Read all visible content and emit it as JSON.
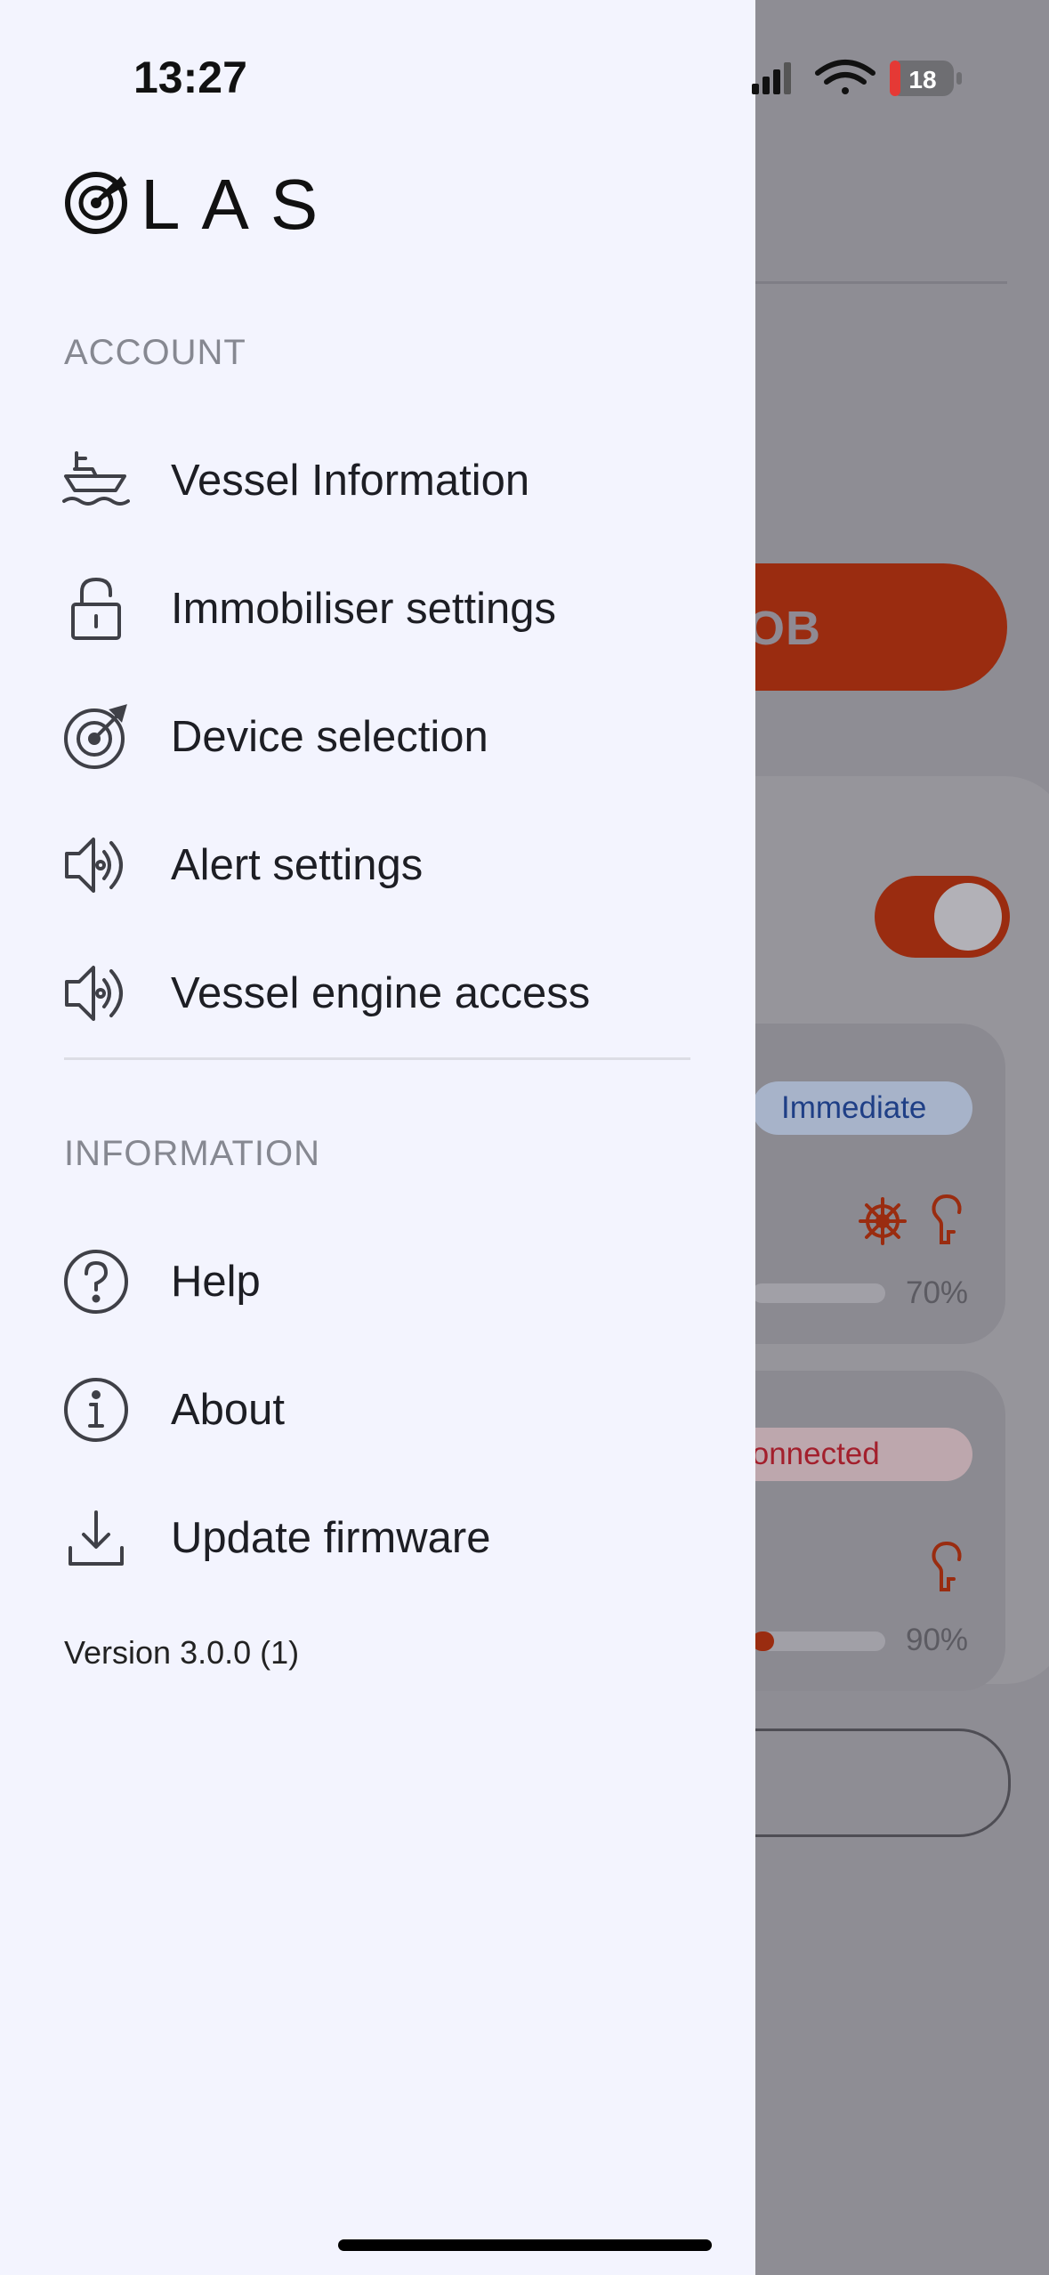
{
  "status_bar": {
    "time": "13:27",
    "battery": "18"
  },
  "app": {
    "logo_text": "LAS"
  },
  "drawer": {
    "account_title": "ACCOUNT",
    "account_items": [
      {
        "label": "Vessel Information",
        "icon": "boat-icon"
      },
      {
        "label": "Immobiliser settings",
        "icon": "unlock-icon"
      },
      {
        "label": "Device selection",
        "icon": "radar-icon"
      },
      {
        "label": "Alert settings",
        "icon": "speaker-icon"
      },
      {
        "label": "Vessel engine access",
        "icon": "speaker-icon"
      }
    ],
    "information_title": "INFORMATION",
    "information_items": [
      {
        "label": "Help",
        "icon": "help-icon"
      },
      {
        "label": "About",
        "icon": "info-icon"
      },
      {
        "label": "Update firmware",
        "icon": "download-icon"
      }
    ],
    "version": "Version 3.0.0 (1)"
  },
  "background": {
    "mob_button": "OB",
    "badge_immediate": "Immediate",
    "badge_not_connected": "t Connected",
    "device1_percent": "70%",
    "device2_percent": "90%",
    "device2_level": 0.9,
    "accent_color": "#9a2c10"
  }
}
